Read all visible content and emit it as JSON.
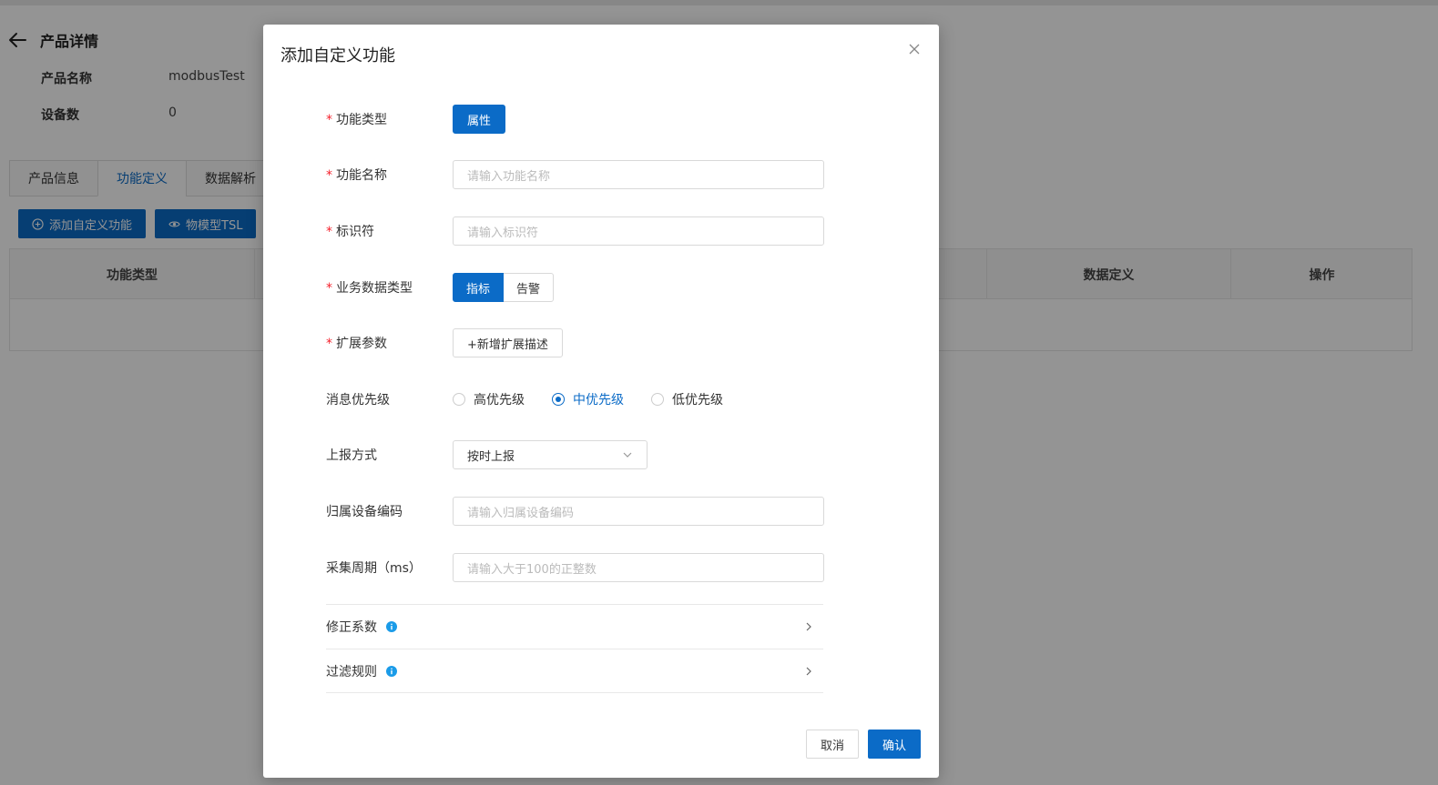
{
  "page": {
    "title": "产品详情",
    "info": [
      {
        "label": "产品名称",
        "value": "modbusTest"
      },
      {
        "label": "设备数",
        "value": "0"
      }
    ],
    "tabs": [
      {
        "label": "产品信息"
      },
      {
        "label": "功能定义"
      },
      {
        "label": "数据解析"
      }
    ],
    "toolbar": {
      "add_label": "添加自定义功能",
      "tsl_label": "物模型TSL"
    },
    "table": {
      "columns": [
        "功能类型",
        "数据定义",
        "操作"
      ]
    }
  },
  "modal": {
    "title": "添加自定义功能",
    "fields": {
      "func_type": {
        "label": "功能类型",
        "value": "属性"
      },
      "func_name": {
        "label": "功能名称",
        "placeholder": "请输入功能名称"
      },
      "identifier": {
        "label": "标识符",
        "placeholder": "请输入标识符"
      },
      "biz_type": {
        "label": "业务数据类型",
        "options": [
          "指标",
          "告警"
        ],
        "selected": "指标"
      },
      "ext_params": {
        "label": "扩展参数",
        "button": "+新增扩展描述"
      },
      "priority": {
        "label": "消息优先级",
        "options": [
          "高优先级",
          "中优先级",
          "低优先级"
        ],
        "selected": "中优先级"
      },
      "report": {
        "label": "上报方式",
        "value": "按时上报"
      },
      "device_code": {
        "label": "归属设备编码",
        "placeholder": "请输入归属设备编码"
      },
      "period": {
        "label": "采集周期（ms）",
        "placeholder": "请输入大于100的正整数"
      }
    },
    "sections": [
      "修正系数",
      "过滤规则"
    ],
    "footer": {
      "cancel": "取消",
      "confirm": "确认"
    }
  },
  "colors": {
    "primary": "#0b6bc7",
    "required": "#f5222d",
    "info": "#1a9be8"
  }
}
